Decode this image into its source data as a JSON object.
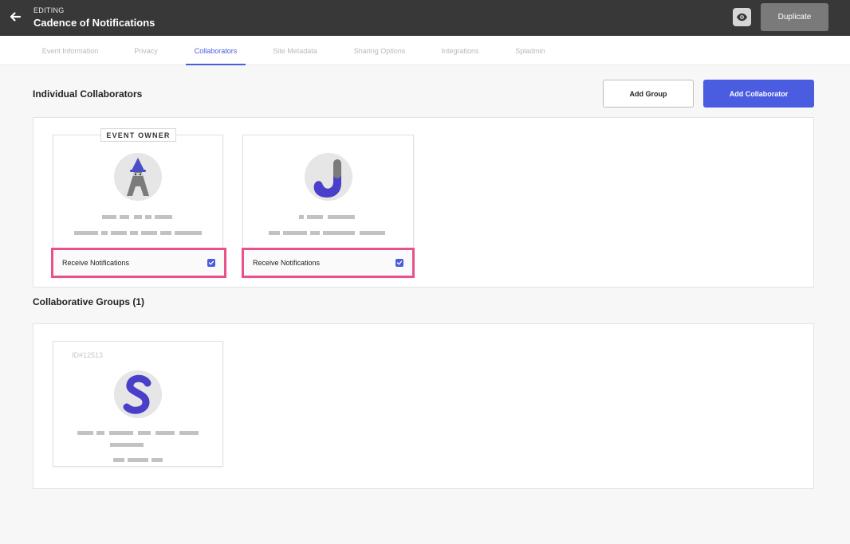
{
  "header": {
    "editing_label": "EDITING",
    "event_title": "Cadence of Notifications",
    "duplicate_label": "Duplicate",
    "back_icon": "arrow-left-icon",
    "preview_icon": "eye-icon"
  },
  "tabs": [
    {
      "label": "Event Information",
      "active": false
    },
    {
      "label": "Privacy",
      "active": false
    },
    {
      "label": "Collaborators",
      "active": true
    },
    {
      "label": "Site Metadata",
      "active": false
    },
    {
      "label": "Sharing Options",
      "active": false
    },
    {
      "label": "Integrations",
      "active": false
    },
    {
      "label": "Spladmin",
      "active": false
    }
  ],
  "individual": {
    "title": "Individual Collaborators",
    "add_group_label": "Add Group",
    "add_collaborator_label": "Add Collaborator",
    "owner_badge": "EVENT OWNER",
    "collaborators": [
      {
        "receive_label": "Receive Notifications",
        "receive_checked": true
      },
      {
        "receive_label": "Receive Notifications",
        "receive_checked": true
      }
    ]
  },
  "groups": {
    "title": "Collaborative Groups (1)",
    "items": [
      {
        "id_label": "ID#12513"
      }
    ]
  },
  "colors": {
    "accent": "#4a5ce0",
    "highlight": "#e8518b",
    "topbar": "#383838"
  }
}
